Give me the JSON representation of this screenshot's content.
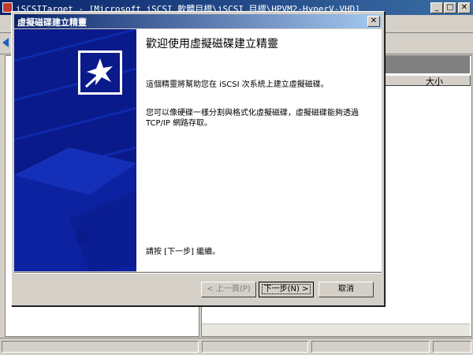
{
  "background_window": {
    "title": "iSCSITarget - [Microsoft iSCSI 軟體目標\\iSCSI 目標\\HPVM2-HyperV-VHD]",
    "window_buttons": {
      "minimize": "_",
      "maximize": "□",
      "close": "✕"
    },
    "column_header_size": "大小"
  },
  "wizard": {
    "title": "虛擬磁碟建立精靈",
    "close_glyph": "✕",
    "heading": "歡迎使用虛擬磁碟建立精靈",
    "paragraph1": "這個精靈將幫助您在 iSCSI 次系統上建立虛擬磁碟。",
    "paragraph2": "您可以像硬碟一樣分割與格式化虛擬磁碟，虛擬磁碟能夠透過 TCP/IP 網路存取。",
    "paragraph3": "請按 [下一步] 繼續。",
    "buttons": {
      "back": "< 上一頁(P)",
      "next": "下一步(N) >",
      "cancel": "取消"
    },
    "banner_icon": "wizard-magic-wand-icon",
    "colors": {
      "banner": "#0a1a8a",
      "titlebar_start": "#0a246a",
      "titlebar_end": "#a6caf0"
    }
  }
}
